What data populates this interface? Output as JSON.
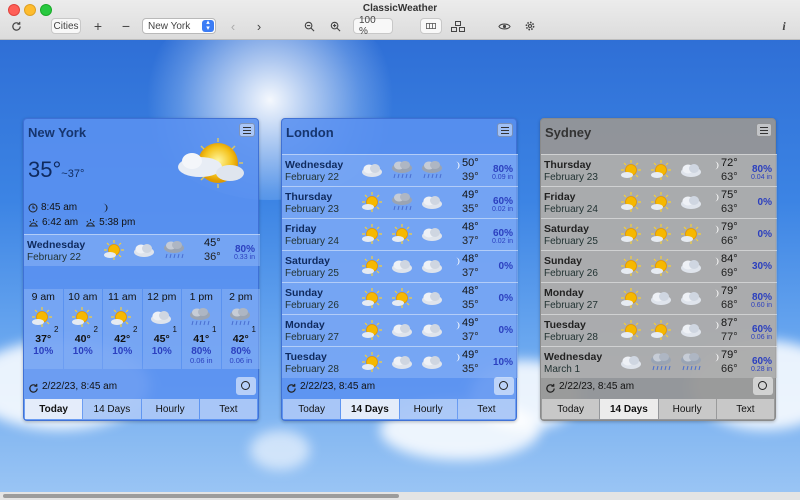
{
  "window": {
    "title": "ClassicWeather"
  },
  "toolbar": {
    "cities_label": "Cities",
    "plus": "+",
    "minus": "−",
    "city_select": "New York",
    "zoom_value": "100 %",
    "info": "i"
  },
  "panels": [
    {
      "city": "New York",
      "current_temp": "35°",
      "current_sub": "~37°",
      "time": "8:45 am",
      "sunrise": "6:42 am",
      "sunset": "5:38 pm",
      "stamp": "2/22/23, 8:45 am",
      "tabs": [
        "Today",
        "14 Days",
        "Hourly",
        "Text"
      ],
      "active_tab": 0,
      "days": [
        {
          "day": "Wednesday",
          "date": "February 22",
          "hi": "45°",
          "lo": "36°",
          "pct": "80%",
          "inch": "0.33 in",
          "icons": [
            "sun",
            "cloud",
            "rain"
          ]
        }
      ],
      "hours": [
        {
          "h": "9 am",
          "t": "37°",
          "sup": "2",
          "p": "10%",
          "inch": "",
          "icon": "sun"
        },
        {
          "h": "10 am",
          "t": "40°",
          "sup": "2",
          "p": "10%",
          "inch": "",
          "icon": "sun"
        },
        {
          "h": "11 am",
          "t": "42°",
          "sup": "2",
          "p": "10%",
          "inch": "",
          "icon": "sun"
        },
        {
          "h": "12 pm",
          "t": "45°",
          "sup": "1",
          "p": "10%",
          "inch": "",
          "icon": "cloud"
        },
        {
          "h": "1 pm",
          "t": "41°",
          "sup": "1",
          "p": "80%",
          "inch": "0.06 in",
          "icon": "rain"
        },
        {
          "h": "2 pm",
          "t": "42°",
          "sup": "1",
          "p": "80%",
          "inch": "0.06 in",
          "icon": "rain"
        }
      ]
    },
    {
      "city": "London",
      "stamp": "2/22/23, 8:45 am",
      "tabs": [
        "Today",
        "14 Days",
        "Hourly",
        "Text"
      ],
      "active_tab": 1,
      "days": [
        {
          "day": "Wednesday",
          "date": "February 22",
          "hi": "50°",
          "lo": "39°",
          "pct": "80%",
          "inch": "0.09 in",
          "icons": [
            "cloud",
            "rain",
            "rain"
          ],
          "moon": true
        },
        {
          "day": "Thursday",
          "date": "February 23",
          "hi": "49°",
          "lo": "35°",
          "pct": "60%",
          "inch": "0.02 in",
          "icons": [
            "sun",
            "rain",
            "cloud"
          ]
        },
        {
          "day": "Friday",
          "date": "February 24",
          "hi": "48°",
          "lo": "37°",
          "pct": "60%",
          "inch": "0.02 in",
          "icons": [
            "sun",
            "sun",
            "cloud"
          ]
        },
        {
          "day": "Saturday",
          "date": "February 25",
          "hi": "48°",
          "lo": "37°",
          "pct": "0%",
          "inch": "",
          "icons": [
            "sun",
            "cloud",
            "cloud"
          ],
          "moon": true
        },
        {
          "day": "Sunday",
          "date": "February 26",
          "hi": "48°",
          "lo": "35°",
          "pct": "0%",
          "inch": "",
          "icons": [
            "sun",
            "sun",
            "cloud"
          ]
        },
        {
          "day": "Monday",
          "date": "February 27",
          "hi": "49°",
          "lo": "37°",
          "pct": "0%",
          "inch": "",
          "icons": [
            "sun",
            "cloud",
            "cloud"
          ],
          "moon": true
        },
        {
          "day": "Tuesday",
          "date": "February 28",
          "hi": "49°",
          "lo": "35°",
          "pct": "10%",
          "inch": "",
          "icons": [
            "sun",
            "cloud",
            "cloud"
          ],
          "moon": true
        }
      ]
    },
    {
      "city": "Sydney",
      "stamp": "2/22/23, 8:45 am",
      "tabs": [
        "Today",
        "14 Days",
        "Hourly",
        "Text"
      ],
      "active_tab": 1,
      "days": [
        {
          "day": "Thursday",
          "date": "February 23",
          "hi": "72°",
          "lo": "63°",
          "pct": "80%",
          "inch": "0.04 in",
          "icons": [
            "sun",
            "sun",
            "cloud"
          ],
          "moon": true
        },
        {
          "day": "Friday",
          "date": "February 24",
          "hi": "75°",
          "lo": "63°",
          "pct": "0%",
          "inch": "",
          "icons": [
            "sun",
            "sun",
            "cloud"
          ],
          "moon": true
        },
        {
          "day": "Saturday",
          "date": "February 25",
          "hi": "79°",
          "lo": "66°",
          "pct": "0%",
          "inch": "",
          "icons": [
            "sun",
            "sun",
            "sun"
          ],
          "moon": true
        },
        {
          "day": "Sunday",
          "date": "February 26",
          "hi": "84°",
          "lo": "69°",
          "pct": "30%",
          "inch": "",
          "icons": [
            "sun",
            "sun",
            "cloud"
          ],
          "moon": true
        },
        {
          "day": "Monday",
          "date": "February 27",
          "hi": "79°",
          "lo": "68°",
          "pct": "80%",
          "inch": "0.60 in",
          "icons": [
            "sun",
            "cloud",
            "cloud"
          ],
          "moon": true
        },
        {
          "day": "Tuesday",
          "date": "February 28",
          "hi": "87°",
          "lo": "77°",
          "pct": "60%",
          "inch": "0.06 in",
          "icons": [
            "sun",
            "sun",
            "cloud"
          ],
          "moon": true
        },
        {
          "day": "Wednesday",
          "date": "March 1",
          "hi": "79°",
          "lo": "66°",
          "pct": "60%",
          "inch": "0.28 in",
          "icons": [
            "cloud",
            "rain",
            "rain"
          ],
          "moon": true
        }
      ]
    }
  ]
}
